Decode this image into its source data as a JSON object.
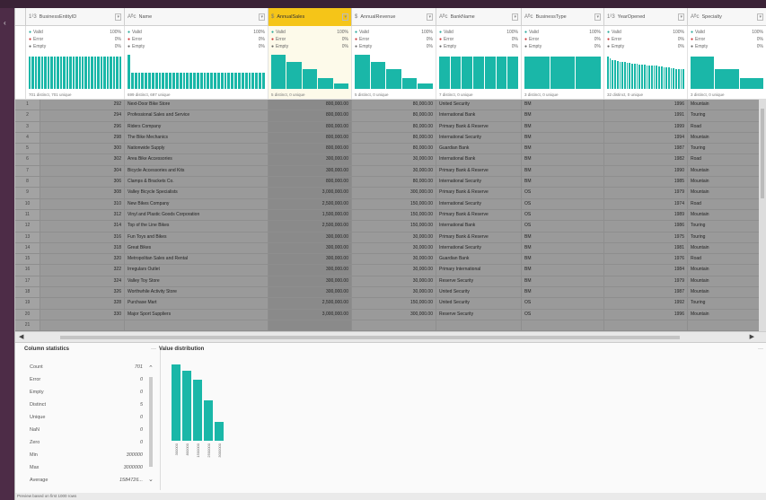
{
  "columns": [
    {
      "type": "1²3",
      "name": "BusinessEntityID",
      "width": 110
    },
    {
      "type": "Aᴮc",
      "name": "Name",
      "width": 160
    },
    {
      "type": "$",
      "name": "AnnualSales",
      "width": 93,
      "selected": true
    },
    {
      "type": "$",
      "name": "AnnualRevenue",
      "width": 94
    },
    {
      "type": "Aᴮc",
      "name": "BankName",
      "width": 95
    },
    {
      "type": "Aᴮc",
      "name": "BusinessType",
      "width": 92
    },
    {
      "type": "1²3",
      "name": "YearOpened",
      "width": 93
    },
    {
      "type": "Aᴮc",
      "name": "Specialty",
      "width": 88
    }
  ],
  "quality": [
    {
      "valid": "100%",
      "error": "0%",
      "empty": "0%",
      "foot": "701 distinct, 701 unique",
      "hist": [
        90,
        90,
        90,
        90,
        90,
        90,
        90,
        90,
        90,
        90,
        90,
        90,
        90,
        90,
        90,
        90,
        90,
        90,
        90,
        90,
        90,
        90,
        90,
        90,
        90,
        90,
        90,
        90,
        90,
        90
      ]
    },
    {
      "valid": "100%",
      "error": "0%",
      "empty": "0%",
      "foot": "699 distinct, 697 unique",
      "hist": [
        95,
        45,
        45,
        45,
        45,
        45,
        45,
        45,
        45,
        45,
        45,
        45,
        45,
        45,
        45,
        45,
        45,
        45,
        45,
        45,
        45,
        45,
        45,
        45,
        45,
        45,
        45,
        45,
        45,
        45,
        45,
        45,
        45,
        45,
        45,
        45,
        45,
        45,
        45,
        45
      ]
    },
    {
      "valid": "100%",
      "error": "0%",
      "empty": "0%",
      "foot": "5 distinct, 0 unique",
      "hist": [
        95,
        75,
        55,
        30,
        15
      ]
    },
    {
      "valid": "100%",
      "error": "0%",
      "empty": "0%",
      "foot": "5 distinct, 0 unique",
      "hist": [
        95,
        75,
        55,
        30,
        15
      ]
    },
    {
      "valid": "100%",
      "error": "0%",
      "empty": "0%",
      "foot": "7 distinct, 0 unique",
      "hist": [
        90,
        90,
        90,
        90,
        90,
        90,
        90
      ]
    },
    {
      "valid": "100%",
      "error": "0%",
      "empty": "0%",
      "foot": "3 distinct, 0 unique",
      "hist": [
        90,
        90,
        90
      ]
    },
    {
      "valid": "100%",
      "error": "0%",
      "empty": "0%",
      "foot": "32 distinct, 0 unique",
      "hist": [
        90,
        85,
        80,
        80,
        78,
        75,
        75,
        75,
        72,
        72,
        70,
        70,
        70,
        68,
        68,
        68,
        65,
        65,
        65,
        65,
        65,
        62,
        62,
        60,
        60,
        60,
        58,
        58,
        55,
        55,
        55,
        55
      ]
    },
    {
      "valid": "100%",
      "error": "0%",
      "empty": "0%",
      "foot": "3 distinct, 0 unique",
      "hist": [
        90,
        55,
        30
      ]
    }
  ],
  "quality_labels": {
    "valid": "Valid",
    "error": "Error",
    "empty": "Empty"
  },
  "rows": [
    [
      "1",
      "292",
      "Next-Door Bike Store",
      "800,000.00",
      "80,000.00",
      "United Security",
      "BM",
      "1996",
      "Mountain"
    ],
    [
      "2",
      "294",
      "Professional Sales and Service",
      "800,000.00",
      "80,000.00",
      "International Bank",
      "BM",
      "1991",
      "Touring"
    ],
    [
      "3",
      "296",
      "Riders Company",
      "800,000.00",
      "80,000.00",
      "Primary Bank & Reserve",
      "BM",
      "1999",
      "Road"
    ],
    [
      "4",
      "298",
      "The Bike Mechanics",
      "800,000.00",
      "80,000.00",
      "International Security",
      "BM",
      "1994",
      "Mountain"
    ],
    [
      "5",
      "300",
      "Nationwide Supply",
      "800,000.00",
      "80,000.00",
      "Guardian Bank",
      "BM",
      "1987",
      "Touring"
    ],
    [
      "6",
      "302",
      "Area Bike Accessories",
      "300,000.00",
      "30,000.00",
      "International Bank",
      "BM",
      "1982",
      "Road"
    ],
    [
      "7",
      "304",
      "Bicycle Accessories and Kits",
      "300,000.00",
      "30,000.00",
      "Primary Bank & Reserve",
      "BM",
      "1990",
      "Mountain"
    ],
    [
      "8",
      "306",
      "Clamps & Brackets Co.",
      "800,000.00",
      "80,000.00",
      "International Security",
      "BM",
      "1985",
      "Mountain"
    ],
    [
      "9",
      "308",
      "Valley Bicycle Specialists",
      "3,000,000.00",
      "300,000.00",
      "Primary Bank & Reserve",
      "OS",
      "1979",
      "Mountain"
    ],
    [
      "10",
      "310",
      "New Bikes Company",
      "2,500,000.00",
      "150,000.00",
      "International Security",
      "OS",
      "1974",
      "Road"
    ],
    [
      "11",
      "312",
      "Vinyl and Plastic Goods Corporation",
      "1,500,000.00",
      "150,000.00",
      "Primary Bank & Reserve",
      "OS",
      "1989",
      "Mountain"
    ],
    [
      "12",
      "314",
      "Top of the Line Bikes",
      "2,500,000.00",
      "150,000.00",
      "International Bank",
      "OS",
      "1986",
      "Touring"
    ],
    [
      "13",
      "316",
      "Fun Toys and Bikes",
      "300,000.00",
      "30,000.00",
      "Primary Bank & Reserve",
      "BM",
      "1975",
      "Touring"
    ],
    [
      "14",
      "318",
      "Great Bikes",
      "300,000.00",
      "30,000.00",
      "International Security",
      "BM",
      "1981",
      "Mountain"
    ],
    [
      "15",
      "320",
      "Metropolitan Sales and Rental",
      "300,000.00",
      "30,000.00",
      "Guardian Bank",
      "BM",
      "1976",
      "Road"
    ],
    [
      "16",
      "322",
      "Irregulars Outlet",
      "300,000.00",
      "30,000.00",
      "Primary International",
      "BM",
      "1984",
      "Mountain"
    ],
    [
      "17",
      "324",
      "Valley Toy Store",
      "300,000.00",
      "30,000.00",
      "Reserve Security",
      "BM",
      "1979",
      "Mountain"
    ],
    [
      "18",
      "326",
      "Worthwhile Activity Store",
      "300,000.00",
      "30,000.00",
      "United Security",
      "BM",
      "1987",
      "Mountain"
    ],
    [
      "19",
      "328",
      "Purchase Mart",
      "2,500,000.00",
      "150,000.00",
      "United Security",
      "OS",
      "1992",
      "Touring"
    ],
    [
      "20",
      "330",
      "Major Sport Suppliers",
      "3,000,000.00",
      "300,000.00",
      "Reserve Security",
      "OS",
      "1996",
      "Mountain"
    ],
    [
      "21",
      "",
      "",
      "",
      "",
      "",
      "",
      "",
      ""
    ]
  ],
  "column_statistics": {
    "title": "Column statistics",
    "more": "···",
    "items": [
      {
        "label": "Count",
        "value": "701"
      },
      {
        "label": "Error",
        "value": "0"
      },
      {
        "label": "Empty",
        "value": "0"
      },
      {
        "label": "Distinct",
        "value": "5"
      },
      {
        "label": "Unique",
        "value": "0"
      },
      {
        "label": "NaN",
        "value": "0"
      },
      {
        "label": "Zero",
        "value": "0"
      },
      {
        "label": "Min",
        "value": "300000"
      },
      {
        "label": "Max",
        "value": "3000000"
      },
      {
        "label": "Average",
        "value": "1584726..."
      }
    ]
  },
  "value_distribution": {
    "title": "Value distribution",
    "more": "···",
    "bars": [
      {
        "label": "300000",
        "value": 100
      },
      {
        "label": "800000",
        "value": 92
      },
      {
        "label": "1500000",
        "value": 80
      },
      {
        "label": "2500000",
        "value": 53
      },
      {
        "label": "3000000",
        "value": 25
      }
    ]
  },
  "status": "Preview based on first 1000 rows",
  "colors": {
    "accent": "#1ab7a8",
    "selected_header": "#f5c518"
  }
}
